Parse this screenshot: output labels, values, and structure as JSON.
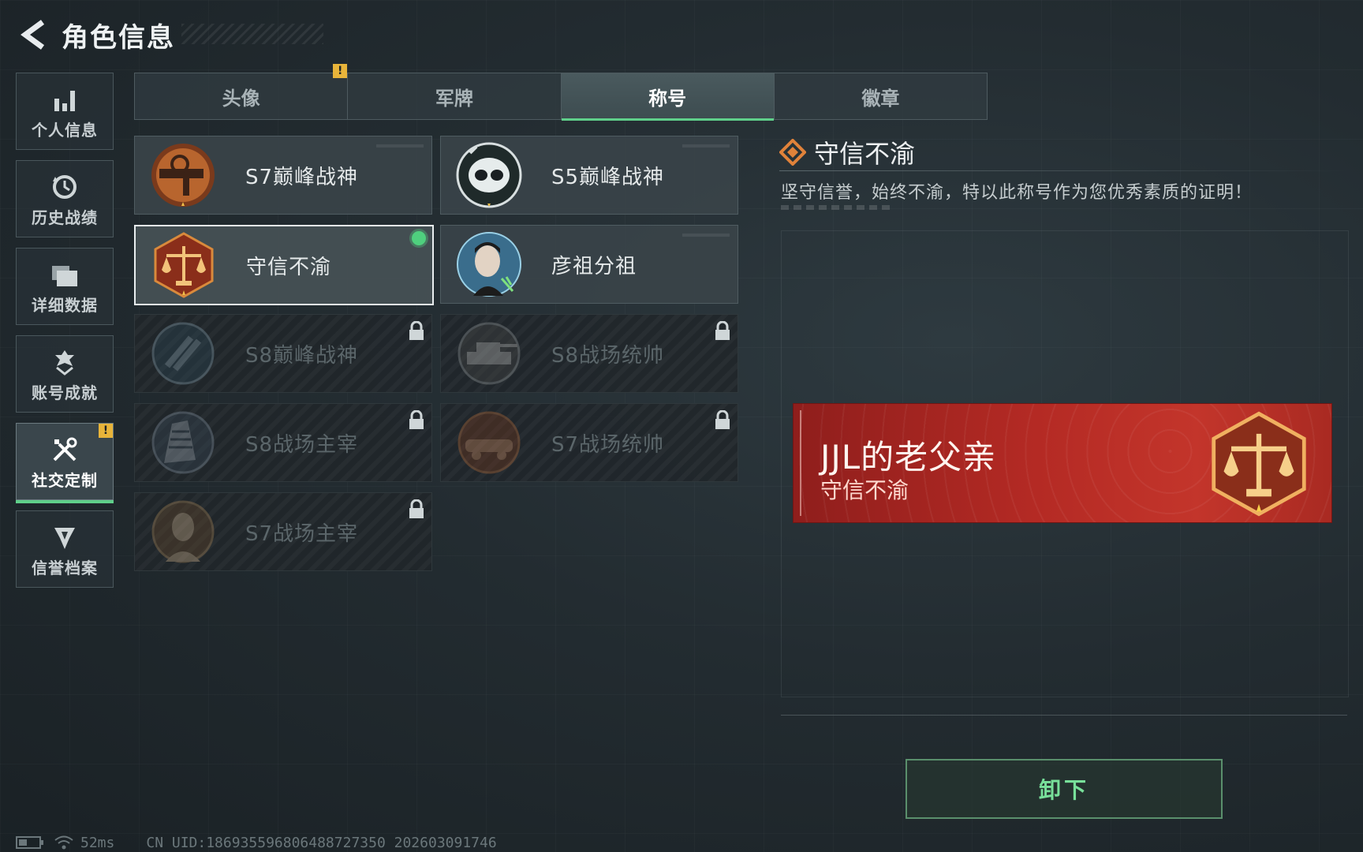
{
  "header": {
    "title": "角色信息"
  },
  "sidebar": {
    "items": [
      {
        "label": "个人信息",
        "icon": "bar-chart-icon",
        "active": false
      },
      {
        "label": "历史战绩",
        "icon": "history-icon",
        "active": false
      },
      {
        "label": "详细数据",
        "icon": "folder-icon",
        "active": false
      },
      {
        "label": "账号成就",
        "icon": "achievement-icon",
        "active": false
      },
      {
        "label": "社交定制",
        "icon": "tools-icon",
        "active": true,
        "badge": "!"
      },
      {
        "label": "信誉档案",
        "icon": "reputation-icon",
        "active": false
      }
    ]
  },
  "tabs": [
    {
      "label": "头像",
      "active": false,
      "badge": "!"
    },
    {
      "label": "军牌",
      "active": false
    },
    {
      "label": "称号",
      "active": true
    },
    {
      "label": "徽章",
      "active": false
    }
  ],
  "titles": [
    {
      "name": "S7巅峰战神",
      "state": "unlocked",
      "emblem": "rifle-emblem-icon"
    },
    {
      "name": "S5巅峰战神",
      "state": "unlocked",
      "emblem": "skull-emblem-icon"
    },
    {
      "name": "守信不渝",
      "state": "selected",
      "emblem": "scales-emblem-icon"
    },
    {
      "name": "彦祖分祖",
      "state": "unlocked",
      "emblem": "portrait-emblem-icon"
    },
    {
      "name": "S8巅峰战神",
      "state": "locked",
      "emblem": "slash-emblem-icon"
    },
    {
      "name": "S8战场统帅",
      "state": "locked",
      "emblem": "tank-emblem-icon"
    },
    {
      "name": "S8战场主宰",
      "state": "locked",
      "emblem": "building-emblem-icon"
    },
    {
      "name": "S7战场统帅",
      "state": "locked",
      "emblem": "vehicle-emblem-icon"
    },
    {
      "name": "S7战场主宰",
      "state": "locked",
      "emblem": "soldier-emblem-icon"
    }
  ],
  "detail": {
    "name": "守信不渝",
    "description": "坚守信誉，始终不渝，特以此称号作为您优秀素质的证明！"
  },
  "banner": {
    "player_name": "JJL的老父亲",
    "title": "守信不渝"
  },
  "action": {
    "unequip_label": "卸下"
  },
  "status": {
    "ping": "52ms",
    "uid": "CN UID:1869355968064887273​50 202603091746"
  },
  "colors": {
    "accent_green": "#5fcf8a",
    "banner_red": "#b42a24",
    "badge_yellow": "#e8b43a",
    "emblem_bronze": "#b8652e"
  }
}
